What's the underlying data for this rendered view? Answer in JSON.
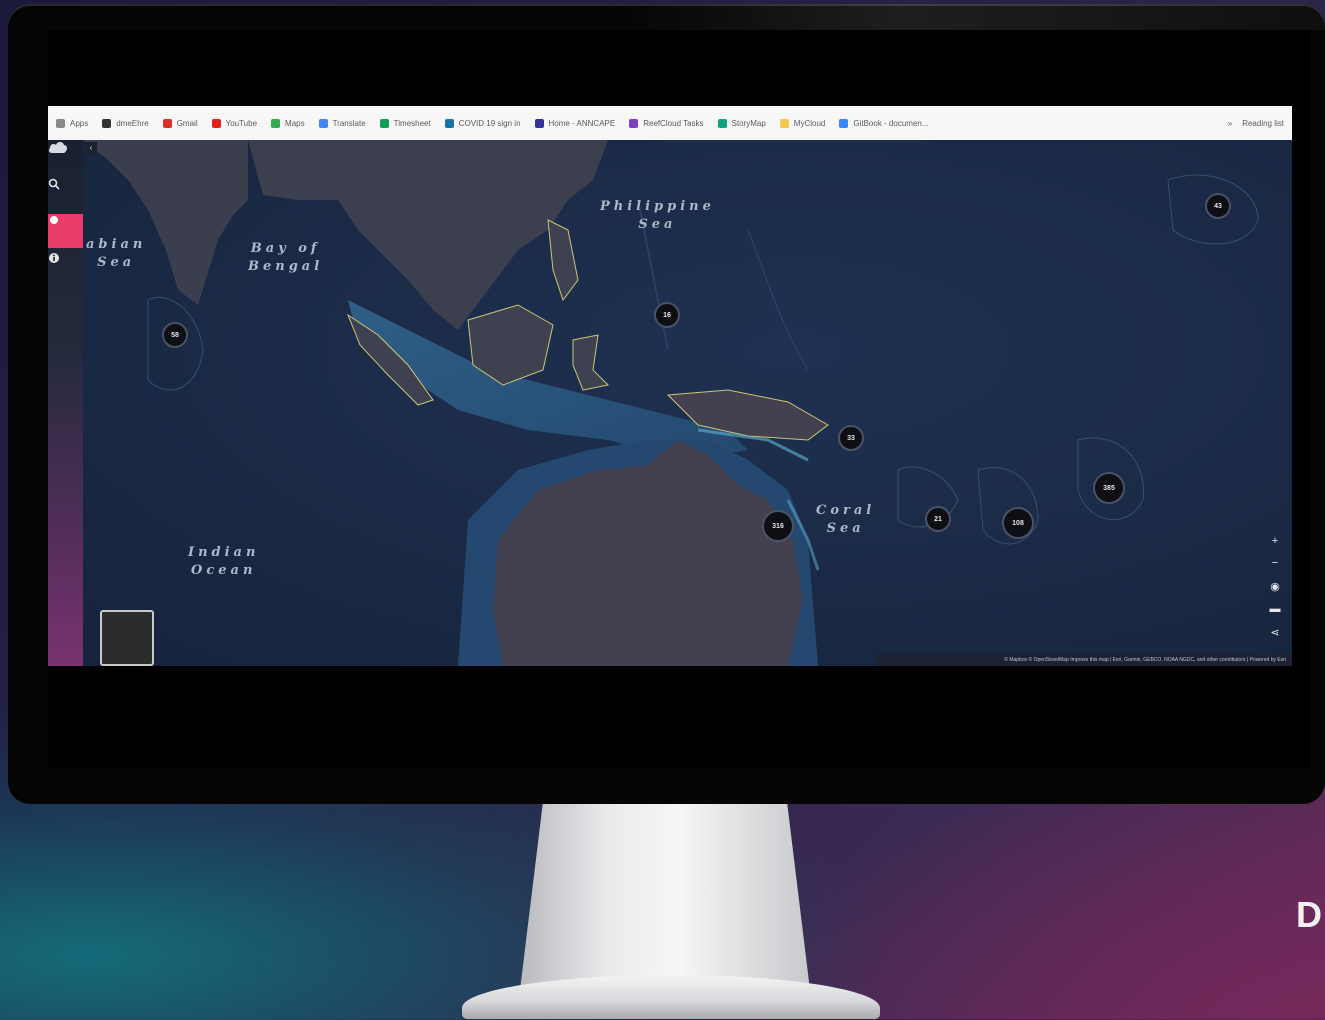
{
  "background": {
    "side_text": "D"
  },
  "browser": {
    "bookmarks": [
      {
        "label": "Apps",
        "icon": "apps-grid-icon",
        "color": "#8a8a8a"
      },
      {
        "label": "dmeEhre",
        "icon": "globe-icon",
        "color": "#333333"
      },
      {
        "label": "Gmail",
        "icon": "gmail-icon",
        "color": "#d93025"
      },
      {
        "label": "YouTube",
        "icon": "youtube-icon",
        "color": "#e62117"
      },
      {
        "label": "Maps",
        "icon": "maps-pin-icon",
        "color": "#34a853"
      },
      {
        "label": "Translate",
        "icon": "translate-icon",
        "color": "#4285f4"
      },
      {
        "label": "Timesheet",
        "icon": "timesheet-icon",
        "color": "#0f9d58"
      },
      {
        "label": "COVID 19 sign in",
        "icon": "covid-icon",
        "color": "#1a73a8"
      },
      {
        "label": "Home - ANNCAPE",
        "icon": "home-icon",
        "color": "#333399"
      },
      {
        "label": "ReefCloud Tasks",
        "icon": "tasks-icon",
        "color": "#7b3fbf"
      },
      {
        "label": "StoryMap",
        "icon": "storymap-icon",
        "color": "#10a37f"
      },
      {
        "label": "MyCloud",
        "icon": "folder-icon",
        "color": "#f2c94c"
      },
      {
        "label": "GitBook - documen...",
        "icon": "gitbook-icon",
        "color": "#3884ff"
      }
    ],
    "more_label": "»",
    "reading_list_label": "Reading list"
  },
  "map": {
    "sidebar": {
      "items": [
        {
          "name": "logo-cloud-icon"
        },
        {
          "name": "search-icon"
        },
        {
          "name": "layers-icon",
          "active": true
        },
        {
          "name": "info-icon"
        }
      ],
      "collapse_label": "‹"
    },
    "labels": {
      "arabian_sea": [
        "abian",
        "Sea"
      ],
      "bay_of_bengal": [
        "Bay of",
        "Bengal"
      ],
      "philippine_sea": [
        "Philippine",
        "Sea"
      ],
      "indian_ocean": [
        "Indian",
        "Ocean"
      ],
      "coral_sea": [
        "Coral",
        "Sea"
      ]
    },
    "clusters": [
      {
        "id": "maldives",
        "count": "58"
      },
      {
        "id": "philippine",
        "count": "16"
      },
      {
        "id": "pacific-ne",
        "count": "43"
      },
      {
        "id": "png",
        "count": "33"
      },
      {
        "id": "gbr",
        "count": "316"
      },
      {
        "id": "solomon",
        "count": "21"
      },
      {
        "id": "vanuatu",
        "count": "108"
      },
      {
        "id": "fiji",
        "count": "385"
      }
    ],
    "controls": [
      "+",
      "−",
      "◉",
      "▬",
      "⋖"
    ],
    "attribution": "© Mapbox © OpenStreetMap Improve this map | Esri, Garmin, GEBCO, NOAA NGDC, and other contributors | Powered by Esri"
  },
  "colors": {
    "accent": "#ea3b6b",
    "ocean_deep": "#1b2b47",
    "land": "#3c4050",
    "reef": "#c9c77a"
  }
}
